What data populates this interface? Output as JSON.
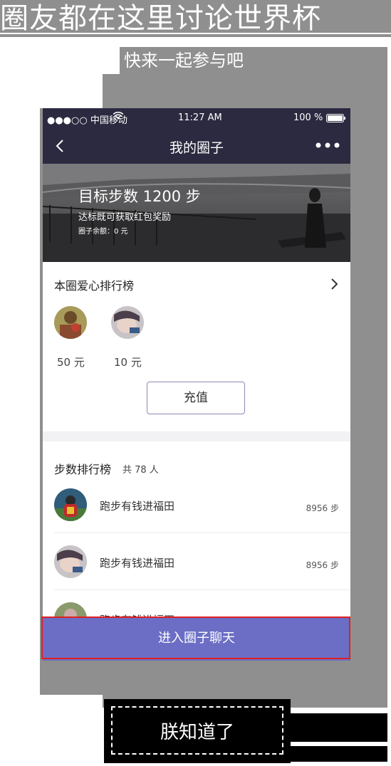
{
  "captions": {
    "headline": "圈友都在这里讨论世界杯",
    "subline": "快来一起参与吧"
  },
  "status_bar": {
    "carrier": "●●●○○ 中国移动",
    "time": "11:27 AM",
    "battery": "100 %"
  },
  "nav": {
    "title": "我的圈子",
    "back_icon": "chevron-left-icon",
    "more_icon": "more-dots-icon"
  },
  "hero": {
    "goal": "目标步数 1200 步",
    "reward": "达标既可获取红包奖励",
    "balance": "圈子余额：0 元"
  },
  "love_board": {
    "title": "本圈爱心排行榜",
    "donors": [
      {
        "amount": "50 元"
      },
      {
        "amount": "10 元"
      }
    ],
    "recharge_label": "充值"
  },
  "step_board": {
    "title": "步数排行榜",
    "count": "共 78 人",
    "rows": [
      {
        "name": "跑步有钱进福田",
        "steps": "8956 步"
      },
      {
        "name": "跑步有钱进福田",
        "steps": "8956 步"
      },
      {
        "name": "跑步有钱进福田",
        "steps": ""
      }
    ]
  },
  "chat_button": "进入圈子聊天",
  "stamp": {
    "label": "朕知道了"
  },
  "colors": {
    "nav_bg": "#2b2a40",
    "accent": "#6b6ec4",
    "highlight_frame": "#e02020",
    "caption_bg": "#8f8f8f"
  }
}
